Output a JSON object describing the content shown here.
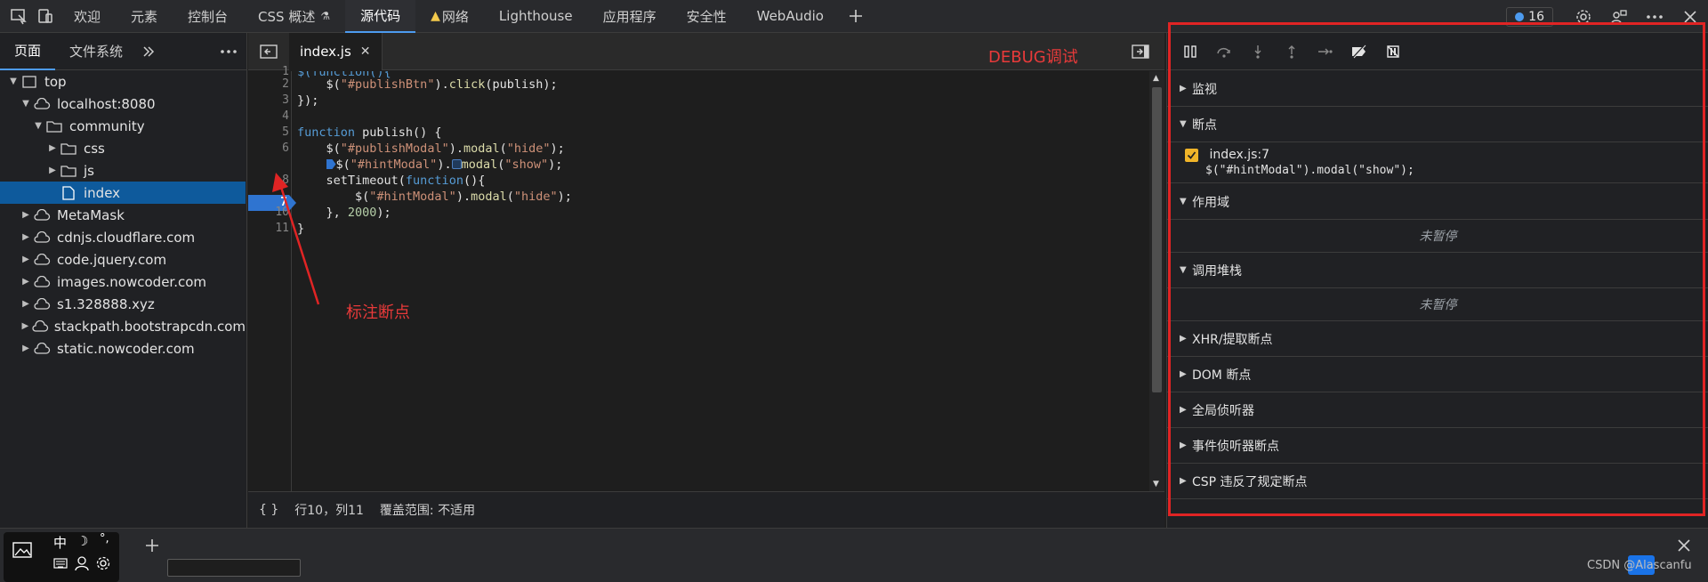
{
  "top_tabs": [
    {
      "label": "欢迎"
    },
    {
      "label": "元素"
    },
    {
      "label": "控制台"
    },
    {
      "label": "CSS 概述"
    },
    {
      "label": "源代码"
    },
    {
      "label": "网络"
    },
    {
      "label": "Lighthouse"
    },
    {
      "label": "应用程序"
    },
    {
      "label": "安全性"
    },
    {
      "label": "WebAudio"
    }
  ],
  "top_right": {
    "issue_count": "16"
  },
  "navigator": {
    "tabs": [
      "页面",
      "文件系统"
    ],
    "tree": [
      {
        "label": "top"
      },
      {
        "label": "localhost:8080"
      },
      {
        "label": "community"
      },
      {
        "label": "css"
      },
      {
        "label": "js"
      },
      {
        "label": "index"
      },
      {
        "label": "MetaMask"
      },
      {
        "label": "cdnjs.cloudflare.com"
      },
      {
        "label": "code.jquery.com"
      },
      {
        "label": "images.nowcoder.com"
      },
      {
        "label": "s1.328888.xyz"
      },
      {
        "label": "stackpath.bootstrapcdn.com"
      },
      {
        "label": "static.nowcoder.com"
      }
    ]
  },
  "editor": {
    "file_tab": "index.js",
    "line_numbers": [
      "1",
      "2",
      "3",
      "4",
      "5",
      "6",
      "7",
      "8",
      "",
      "10",
      "11"
    ],
    "breakpoint_line": "7",
    "code": {
      "l1": "$(function(){",
      "l2": "    $(\"#publishBtn\").click(publish);",
      "l3": "});",
      "l5": "function publish() {",
      "l6": "    $(\"#publishModal\").modal(\"hide\");",
      "l7": "    $(\"#hintModal\").modal(\"show\");",
      "l8": "    setTimeout(function(){",
      "l9": "        $(\"#hintModal\").modal(\"hide\");",
      "l10": "    }, 2000);",
      "l11": "}"
    },
    "status": {
      "braces": "{ }",
      "position": "行10，列11",
      "coverage": "覆盖范围: 不适用"
    }
  },
  "debugger": {
    "sections": {
      "watch": "监视",
      "breakpoints": "断点",
      "scope": "作用域",
      "call_stack": "调用堆栈",
      "xhr": "XHR/提取断点",
      "dom": "DOM 断点",
      "global": "全局侦听器",
      "event": "事件侦听器断点",
      "csp": "CSP 违反了规定断点"
    },
    "breakpoint_item": {
      "file": "index.js:7",
      "code": "$(\"#hintModal\").modal(\"show\");"
    },
    "not_paused": "未暂停"
  },
  "annotations": {
    "debug_label": "DEBUG调试",
    "breakpoint_label": "标注断点",
    "color": "#e02424"
  },
  "watermark": "CSDN @Alascanfu",
  "colors": {
    "accent": "#4d9bef",
    "breakpoint": "#2f74d0",
    "checkbox": "#f0b429"
  }
}
